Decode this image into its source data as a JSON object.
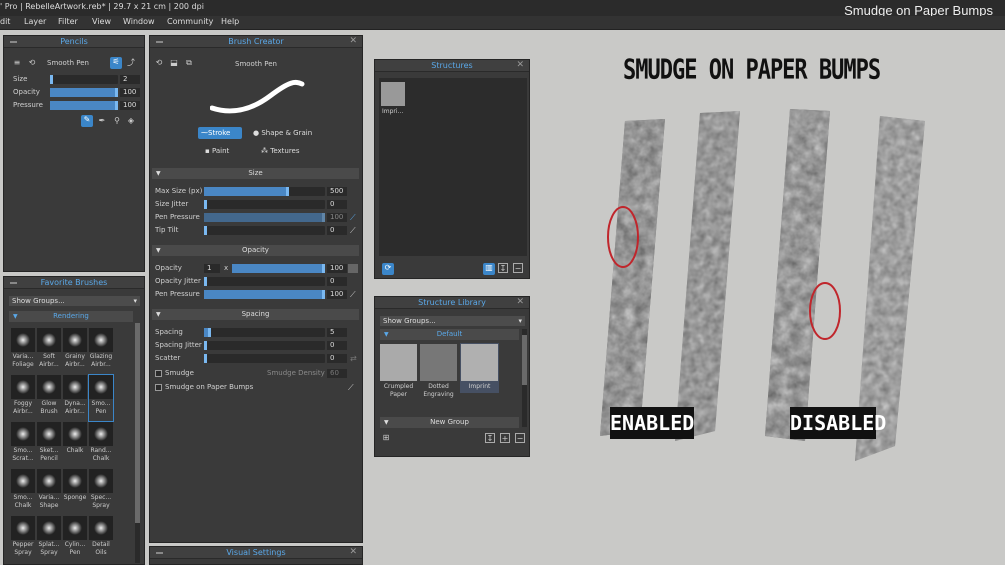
{
  "window": {
    "title": "' Pro | RebelleArtwork.reb* | 29.7 x 21 cm | 200 dpi",
    "overlay_title": "Smudge on Paper Bumps"
  },
  "menu": [
    "dit",
    "Layer",
    "Filter",
    "View",
    "Window",
    "Community",
    "Help"
  ],
  "pencils": {
    "title": "Pencils",
    "brush_name": "Smooth Pen",
    "size_label": "Size",
    "size_value": "2",
    "size_fill": 0.02,
    "opacity_label": "Opacity",
    "opacity_value": "100",
    "opacity_fill": 1.0,
    "pressure_label": "Pressure",
    "pressure_value": "100",
    "pressure_fill": 1.0
  },
  "favorites": {
    "title": "Favorite Brushes",
    "show_groups": "Show Groups...",
    "group": "Rendering",
    "brushes": [
      {
        "n1": "Varia...",
        "n2": "Foliage"
      },
      {
        "n1": "Soft",
        "n2": "Airbr..."
      },
      {
        "n1": "Grainy",
        "n2": "Airbr..."
      },
      {
        "n1": "Glazing",
        "n2": "Airbr..."
      },
      {
        "n1": "Foggy",
        "n2": "Airbr..."
      },
      {
        "n1": "Glow",
        "n2": "Brush"
      },
      {
        "n1": "Dyna...",
        "n2": "Airbr..."
      },
      {
        "n1": "Smo...",
        "n2": "Pen"
      },
      {
        "n1": "Smo...",
        "n2": "Scrat..."
      },
      {
        "n1": "Sket...",
        "n2": "Pencil"
      },
      {
        "n1": "Chalk",
        "n2": ""
      },
      {
        "n1": "Rand...",
        "n2": "Chalk"
      },
      {
        "n1": "Smo...",
        "n2": "Chalk"
      },
      {
        "n1": "Varia...",
        "n2": "Shape"
      },
      {
        "n1": "Sponge",
        "n2": ""
      },
      {
        "n1": "Spec...",
        "n2": "Spray"
      },
      {
        "n1": "Pepper",
        "n2": "Spray"
      },
      {
        "n1": "Splat...",
        "n2": "Spray"
      },
      {
        "n1": "Cylin...",
        "n2": "Pen"
      },
      {
        "n1": "Detail",
        "n2": "Oils"
      }
    ]
  },
  "brush_creator": {
    "title": "Brush Creator",
    "brush_name": "Smooth Pen",
    "tabs": {
      "stroke": "Stroke",
      "shape": "Shape & Grain",
      "paint": "Paint",
      "textures": "Textures"
    },
    "size_section": "Size",
    "max_size_label": "Max Size (px)",
    "max_size_value": "500",
    "max_size_fill": 0.69,
    "size_jitter_label": "Size Jitter",
    "size_jitter_value": "0",
    "pen_pressure_label": "Pen Pressure",
    "pen_pressure_value": "100",
    "tip_tilt_label": "Tip Tilt",
    "tip_tilt_value": "0",
    "opacity_section": "Opacity",
    "opacity_label": "Opacity",
    "opacity_num": "1",
    "opacity_x": "x",
    "opacity_value": "100",
    "opacity_jitter_label": "Opacity Jitter",
    "opacity_jitter_value": "0",
    "op_pressure_label": "Pen Pressure",
    "op_pressure_value": "100",
    "spacing_section": "Spacing",
    "spacing_label": "Spacing",
    "spacing_value": "5",
    "spacing_jitter_label": "Spacing Jitter",
    "spacing_jitter_value": "0",
    "scatter_label": "Scatter",
    "scatter_value": "0",
    "smudge_label": "Smudge",
    "smudge_density_label": "Smudge Density",
    "smudge_density_value": "60",
    "smudge_bumps_label": "Smudge on Paper Bumps"
  },
  "visual_settings": {
    "title": "Visual Settings"
  },
  "structures": {
    "title": "Structures",
    "item": "Impri..."
  },
  "structure_library": {
    "title": "Structure Library",
    "show_groups": "Show Groups...",
    "group": "Default",
    "items": [
      {
        "n1": "Crumpled",
        "n2": "Paper"
      },
      {
        "n1": "Dotted",
        "n2": "Engraving"
      },
      {
        "n1": "Imprint",
        "n2": ""
      }
    ],
    "new_group": "New Group"
  },
  "artwork": {
    "heading": "SMUDGE ON PAPER BUMPS",
    "enabled": "ENABLED",
    "disabled": "DISABLED",
    "circle_color": "#c0262c"
  },
  "colors": {
    "accent": "#3b86c9",
    "panel": "#3a3a3a"
  }
}
